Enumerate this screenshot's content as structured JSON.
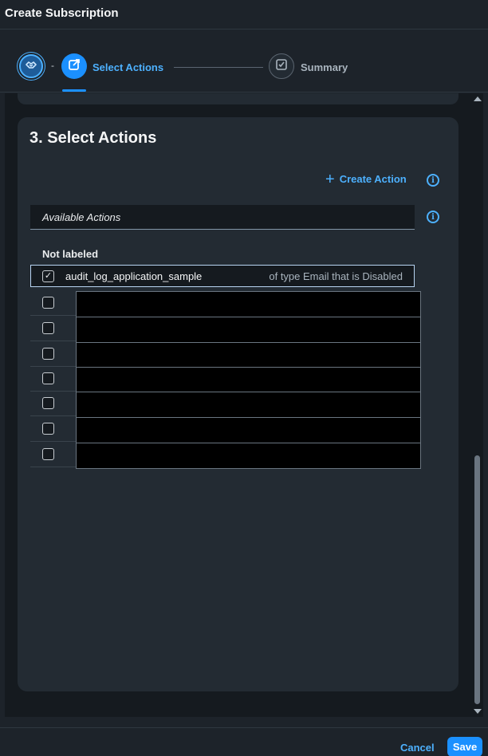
{
  "header": {
    "title": "Create Subscription"
  },
  "wizard": {
    "steps": [
      {
        "label": "",
        "icon": "handshake-icon"
      },
      {
        "label": "Select Actions",
        "icon": "edit-action-icon"
      },
      {
        "label": "Summary",
        "icon": "checklist-icon"
      }
    ],
    "separator": "-"
  },
  "section": {
    "title": "3. Select Actions",
    "create_action_label": "Create Action",
    "available_label": "Available Actions",
    "group_label": "Not labeled",
    "rows": [
      {
        "name": "audit_log_application_sample",
        "meta": "of type Email that is Disabled",
        "checked": true,
        "redacted": false
      },
      {
        "name": "",
        "meta": "",
        "checked": false,
        "redacted": true
      },
      {
        "name": "",
        "meta": "",
        "checked": false,
        "redacted": true
      },
      {
        "name": "",
        "meta": "",
        "checked": false,
        "redacted": true
      },
      {
        "name": "",
        "meta": "",
        "checked": false,
        "redacted": true
      },
      {
        "name": "",
        "meta": "",
        "checked": false,
        "redacted": true
      },
      {
        "name": "",
        "meta": "",
        "checked": false,
        "redacted": true
      },
      {
        "name": "",
        "meta": "",
        "checked": false,
        "redacted": true
      }
    ]
  },
  "footer": {
    "cancel_label": "Cancel",
    "save_label": "Save"
  },
  "colors": {
    "accent": "#1b90ff",
    "link": "#4db1ff",
    "background": "#1d232a",
    "card": "#232b33"
  }
}
